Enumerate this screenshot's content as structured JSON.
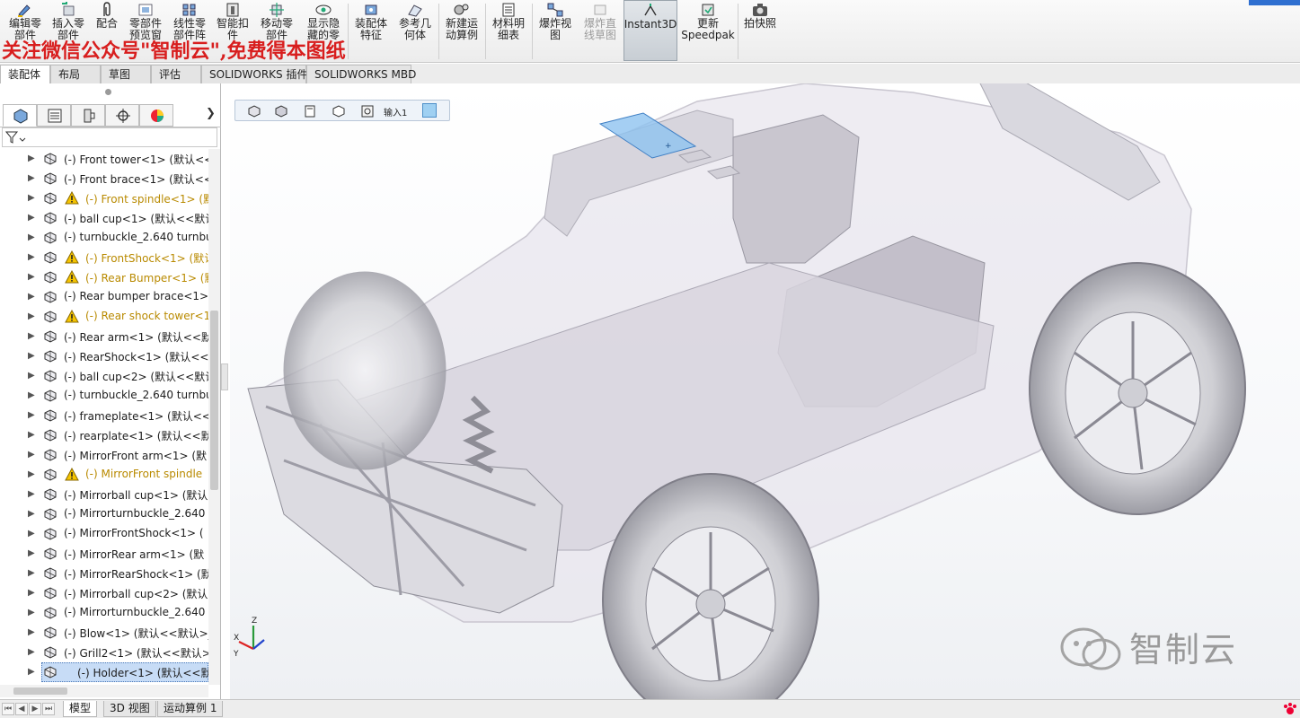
{
  "ribbon": {
    "buttons": [
      {
        "label": "编辑零\n部件",
        "icon": "edit-component-icon"
      },
      {
        "label": "插入零\n部件",
        "icon": "insert-component-icon"
      },
      {
        "label": "配合",
        "icon": "mate-icon"
      },
      {
        "label": "零部件\n预览窗",
        "icon": "component-preview-icon"
      },
      {
        "label": "线性零\n部件阵",
        "icon": "linear-pattern-icon"
      },
      {
        "label": "智能扣\n件",
        "icon": "smart-fastener-icon"
      },
      {
        "label": "移动零\n部件",
        "icon": "move-component-icon"
      },
      {
        "label": "显示隐\n藏的零",
        "icon": "show-hidden-icon"
      },
      {
        "label": "装配体\n特征",
        "icon": "assembly-feature-icon"
      },
      {
        "label": "参考几\n何体",
        "icon": "reference-geometry-icon"
      },
      {
        "label": "新建运\n动算例",
        "icon": "new-motion-study-icon"
      },
      {
        "label": "材料明\n细表",
        "icon": "bill-of-materials-icon"
      },
      {
        "label": "爆炸视\n图",
        "icon": "exploded-view-icon"
      },
      {
        "label": "爆炸直\n线草图",
        "icon": "explode-line-sketch-icon"
      },
      {
        "label": "Instant3D",
        "icon": "instant3d-icon"
      },
      {
        "label": "更新\nSpeedpak",
        "icon": "update-speedpak-icon"
      },
      {
        "label": "拍快照",
        "icon": "snapshot-icon"
      }
    ],
    "watermark": "关注微信公众号\"智制云\",免费得本图纸"
  },
  "command_tabs": [
    "装配体",
    "布局",
    "草图",
    "评估",
    "SOLIDWORKS 插件",
    "SOLIDWORKS MBD"
  ],
  "feature_tree": {
    "items": [
      {
        "label": "(-) Front tower<1> (默认<<",
        "warning": false
      },
      {
        "label": "(-) Front brace<1> (默认<<",
        "warning": false
      },
      {
        "label": "(-) Front spindle<1> (默",
        "warning": true
      },
      {
        "label": "(-) ball cup<1> (默认<<默认",
        "warning": false
      },
      {
        "label": "(-) turnbuckle_2.640 turnbuc",
        "warning": false
      },
      {
        "label": "(-) FrontShock<1> (默认",
        "warning": true
      },
      {
        "label": "(-) Rear Bumper<1> (默",
        "warning": true
      },
      {
        "label": "(-) Rear bumper brace<1>",
        "warning": false
      },
      {
        "label": "(-) Rear shock tower<1",
        "warning": true
      },
      {
        "label": "(-) Rear arm<1> (默认<<默",
        "warning": false
      },
      {
        "label": "(-) RearShock<1> (默认<<默",
        "warning": false
      },
      {
        "label": "(-) ball cup<2> (默认<<默认",
        "warning": false
      },
      {
        "label": "(-) turnbuckle_2.640 turnbu",
        "warning": false
      },
      {
        "label": "(-) frameplate<1> (默认<<默",
        "warning": false
      },
      {
        "label": "(-) rearplate<1> (默认<<默",
        "warning": false
      },
      {
        "label": "(-) MirrorFront arm<1> (默",
        "warning": false
      },
      {
        "label": "(-) MirrorFront spindle",
        "warning": true
      },
      {
        "label": "(-) Mirrorball cup<1> (默认",
        "warning": false
      },
      {
        "label": "(-) Mirrorturnbuckle_2.640 t",
        "warning": false
      },
      {
        "label": "(-) MirrorFrontShock<1> (",
        "warning": false
      },
      {
        "label": "(-) MirrorRear arm<1> (默",
        "warning": false
      },
      {
        "label": "(-) MirrorRearShock<1> (默",
        "warning": false
      },
      {
        "label": "(-) Mirrorball cup<2> (默认",
        "warning": false
      },
      {
        "label": "(-) Mirrorturnbuckle_2.640 t",
        "warning": false
      },
      {
        "label": "(-) Blow<1> (默认<<默认>_",
        "warning": false
      },
      {
        "label": "(-) Grill2<1> (默认<<默认>_",
        "warning": false
      },
      {
        "label": "(-) Holder<1> (默认<<默认>",
        "warning": false,
        "selected": true
      }
    ]
  },
  "bottom_tabs": [
    "模型",
    "3D 视图",
    "运动算例 1"
  ],
  "graphics": {
    "breadcrumb_label": "输入1",
    "watermark": "智制云",
    "triad_labels": {
      "x": "X",
      "y": "Y",
      "z": "Z"
    }
  },
  "colors": {
    "accent": "#2f6fd0",
    "selection": "#c7dcf6",
    "warning": "#e6a800",
    "watermark_red": "#d81e1e"
  }
}
